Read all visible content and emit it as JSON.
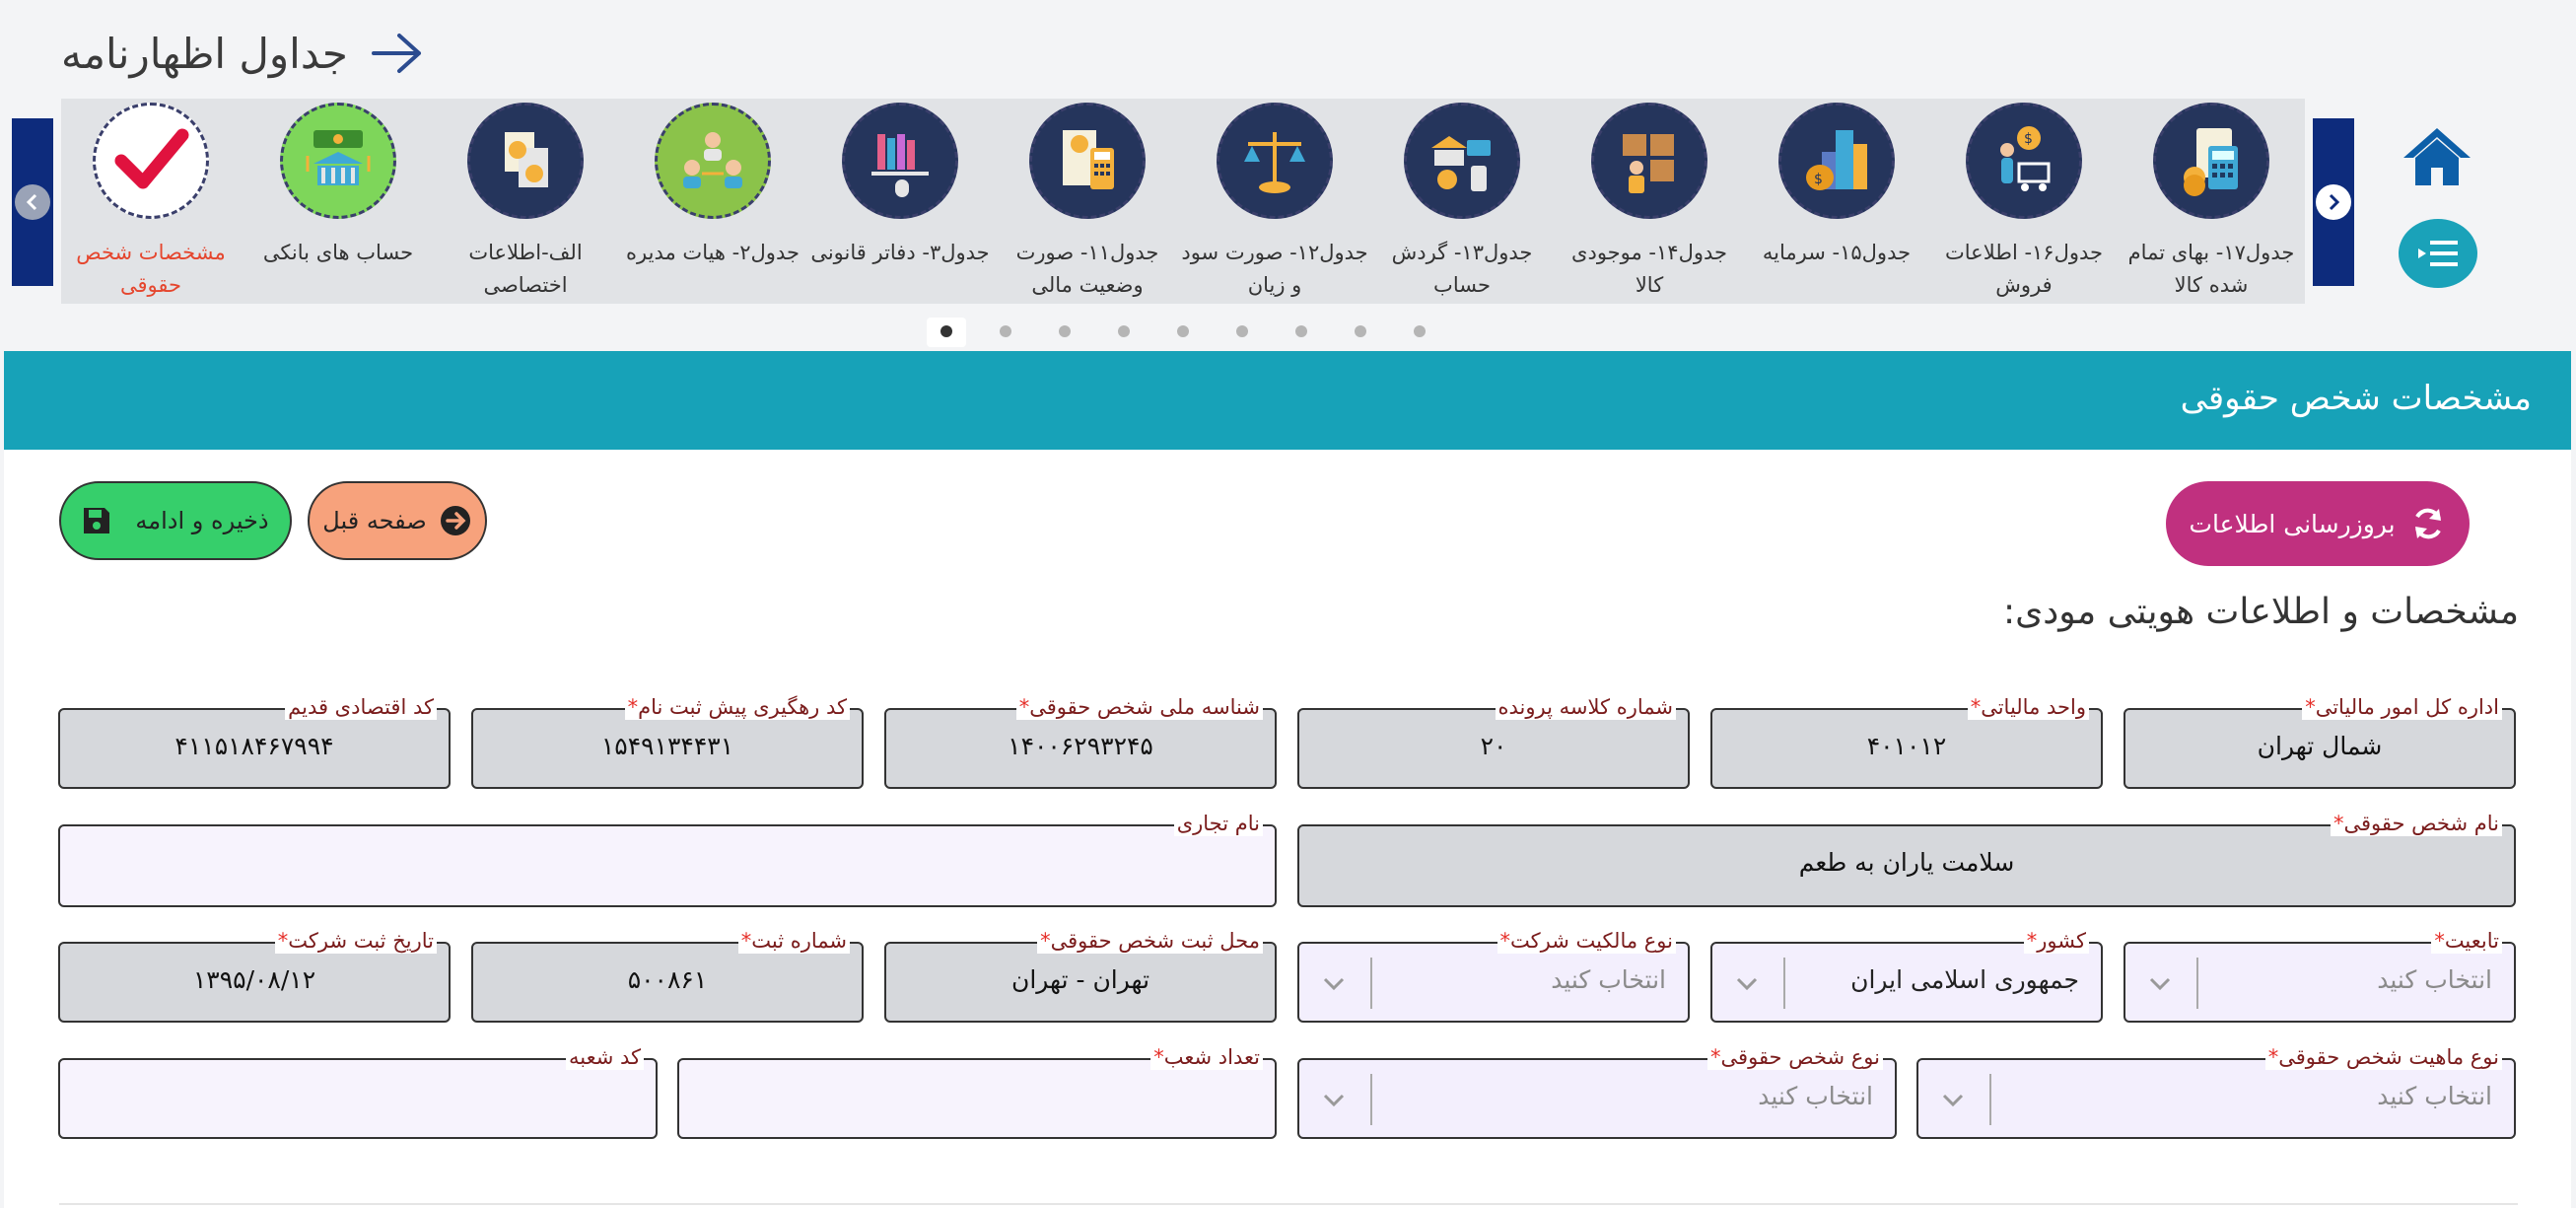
{
  "header": {
    "title": "جداول اظهارنامه"
  },
  "carousel": {
    "steps": [
      {
        "label": "جدول۱۷- بهای تمام شده کالا",
        "icon": "calculator-money-icon"
      },
      {
        "label": "جدول۱۶- اطلاعات فروش",
        "icon": "shopping-cart-icon"
      },
      {
        "label": "جدول۱۵- سرمایه",
        "icon": "money-bag-building-icon"
      },
      {
        "label": "جدول۱۴- موجودی کالا",
        "icon": "inventory-boxes-icon"
      },
      {
        "label": "جدول۱۳- گردش حساب",
        "icon": "bank-transactions-icon"
      },
      {
        "label": "جدول۱۲- صورت سود و زیان",
        "icon": "balance-scale-icon"
      },
      {
        "label": "جدول۱۱- صورت وضعیت مالی",
        "icon": "financial-report-icon"
      },
      {
        "label": "جدول۳- دفاتر قانونی",
        "icon": "books-icon"
      },
      {
        "label": "جدول۲- هیات مدیره",
        "icon": "board-members-icon"
      },
      {
        "label": "الف-اطلاعات اختصاصی",
        "icon": "documents-coin-icon"
      },
      {
        "label": "حساب های بانکی",
        "icon": "bank-account-icon"
      },
      {
        "label": "مشخصات شخص حقوقی",
        "icon": "checkmark-icon",
        "active": true
      }
    ],
    "page_count": 9,
    "active_page": 1
  },
  "card": {
    "title": "مشخصات شخص حقوقی"
  },
  "buttons": {
    "update": "بروزرسانی اطلاعات",
    "prev": "صفحه قبل",
    "save": "ذخیره و ادامه"
  },
  "section": {
    "title": "مشخصات و اطلاعات هویتی مودی:"
  },
  "fields": {
    "tax_office": {
      "label": "اداره کل امور مالیاتی",
      "value": "شمال تهران"
    },
    "tax_unit": {
      "label": "واحد مالیاتی",
      "value": "۴۰۱۰۱۲"
    },
    "file_class": {
      "label": "شماره کلاسه پرونده",
      "value": "۲۰"
    },
    "national_id": {
      "label": "شناسه ملی شخص حقوقی",
      "value": "۱۴۰۰۶۲۹۳۲۴۵"
    },
    "tracking_code": {
      "label": "کد رهگیری پیش ثبت نام",
      "value": "۱۵۴۹۱۳۴۴۳۱"
    },
    "old_econ_code": {
      "label": "کد اقتصادی قدیم",
      "value": "۴۱۱۵۱۸۴۶۷۹۹۴"
    },
    "company_name": {
      "label": "نام شخص حقوقی",
      "value": "سلامت یاران به طعم"
    },
    "trade_name": {
      "label": "نام تجاری",
      "value": ""
    },
    "nationality": {
      "label": "تابعیت",
      "placeholder": "انتخاب کنید"
    },
    "country": {
      "label": "کشور",
      "value": "جمهوری اسلامی ایران"
    },
    "ownership_type": {
      "label": "نوع مالکیت شرکت",
      "placeholder": "انتخاب کنید"
    },
    "reg_place": {
      "label": "محل ثبت شخص حقوقی",
      "value": "تهران - تهران"
    },
    "reg_number": {
      "label": "شماره ثبت",
      "value": "۵۰۰۸۶۱"
    },
    "reg_date": {
      "label": "تاریخ ثبت شرکت",
      "value": "۱۳۹۵/۰۸/۱۲"
    },
    "entity_nature": {
      "label": "نوع ماهیت شخص حقوقی",
      "placeholder": "انتخاب کنید"
    },
    "entity_type": {
      "label": "نوع شخص حقوقی",
      "placeholder": "انتخاب کنید"
    },
    "branch_count": {
      "label": "تعداد شعب",
      "value": ""
    },
    "branch_code": {
      "label": "کد شعبه",
      "value": ""
    }
  },
  "colors": {
    "header_bar": "#17a2b8",
    "update_button": "#c0307f",
    "prev_button": "#f7a27c",
    "save_button": "#36cf6b",
    "carousel_nav": "#0d2b7c",
    "active_step": "#e5462e"
  }
}
